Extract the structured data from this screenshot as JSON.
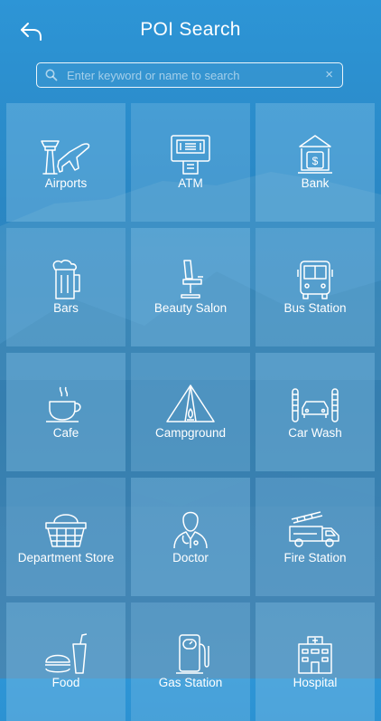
{
  "header": {
    "title": "POI Search",
    "back_icon": "back-arrow-icon"
  },
  "search": {
    "placeholder": "Enter keyword or name to search",
    "value": "",
    "clear_symbol": "×"
  },
  "categories": [
    {
      "label": "Airports",
      "icon": "airport-icon"
    },
    {
      "label": "ATM",
      "icon": "atm-icon"
    },
    {
      "label": "Bank",
      "icon": "bank-icon"
    },
    {
      "label": "Bars",
      "icon": "beer-mug-icon"
    },
    {
      "label": "Beauty Salon",
      "icon": "salon-chair-icon"
    },
    {
      "label": "Bus Station",
      "icon": "bus-icon"
    },
    {
      "label": "Cafe",
      "icon": "coffee-cup-icon"
    },
    {
      "label": "Campground",
      "icon": "tent-icon"
    },
    {
      "label": "Car Wash",
      "icon": "car-wash-icon"
    },
    {
      "label": "Department Store",
      "icon": "shopping-basket-icon"
    },
    {
      "label": "Doctor",
      "icon": "doctor-icon"
    },
    {
      "label": "Fire Station",
      "icon": "fire-truck-icon"
    },
    {
      "label": "Food",
      "icon": "fast-food-icon"
    },
    {
      "label": "Gas Station",
      "icon": "gas-pump-icon"
    },
    {
      "label": "Hospital",
      "icon": "hospital-icon"
    }
  ]
}
